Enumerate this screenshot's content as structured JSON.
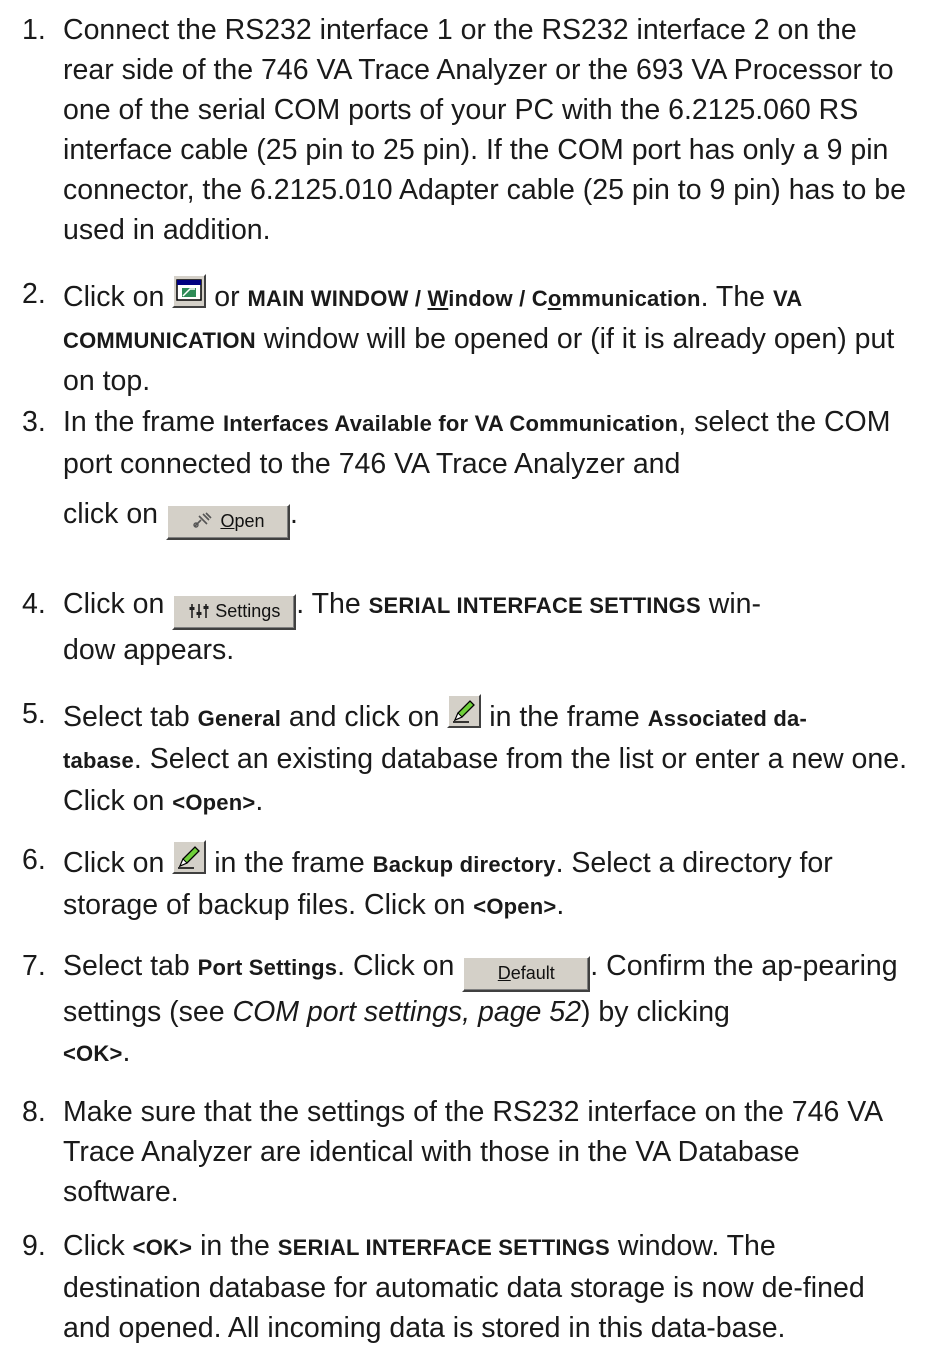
{
  "steps": [
    {
      "num": "1.",
      "text": "Connect the RS232 interface 1 or the RS232 interface 2 on the rear side of the 746 VA Trace Analyzer or the 693 VA Processor to one of the serial COM ports of your PC with the 6.2125.060 RS interface cable (25 pin to 25 pin). If the COM port has only a 9 pin connector, the 6.2125.010 Adapter cable (25 pin to 9 pin) has to be used in addition."
    },
    {
      "num": "2.",
      "pre": "Click on",
      "or": " or ",
      "menu_a": "MAIN WINDOW / ",
      "menu_w": "W",
      "menu_b": "indow / C",
      "menu_o": "o",
      "menu_c": "mmunication",
      "mid": ". The",
      "window_name": "VA COMMUNICATION",
      "post": " window will be opened or (if it is already open) put on top."
    },
    {
      "num": "3.",
      "pre": "In the frame ",
      "frame_name": "Interfaces Available for VA Communication",
      "mid": ", select the COM port connected to the 746 VA Trace Analyzer and",
      "click": "click on",
      "button_label_u": "O",
      "button_label": "pen",
      "post": "."
    },
    {
      "num": "4.",
      "pre": "Click on",
      "button_label": "Settings",
      "mid": ". The ",
      "window_name": "SERIAL INTERFACE SETTINGS",
      "post_line1": " win-",
      "post_line2": "dow appears."
    },
    {
      "num": "5.",
      "pre": "Select tab ",
      "tab_name": "General",
      "mid": " and click on",
      "mid2": " in the frame ",
      "frame_name_1": "Associated da-",
      "frame_name_2": "tabase",
      "post": ". Select an existing database from the list or enter a new one. Click on ",
      "key": "<Open>",
      "end": "."
    },
    {
      "num": "6.",
      "pre": "Click on",
      "mid": " in the frame ",
      "frame_name": "Backup directory",
      "post": ". Select a directory for storage of backup files. Click on ",
      "key": "<Open>",
      "end": "."
    },
    {
      "num": "7.",
      "pre": "Select tab ",
      "tab_name": "Port Settings",
      "mid": ". Click on",
      "button_label_u": "D",
      "button_label": "efault",
      "post": ". Confirm the ap-pearing settings (see ",
      "ref": "COM port settings, page 52",
      "post2": ") by clicking",
      "key": "<OK>",
      "end": "."
    },
    {
      "num": "8.",
      "text": "Make sure that the settings of the RS232 interface on the 746 VA Trace Analyzer are identical with those in the VA Database software."
    },
    {
      "num": "9.",
      "pre": "Click ",
      "key": "<OK>",
      "mid": " in the ",
      "window_name": "SERIAL INTERFACE SETTINGS",
      "post": " window. The destination database for automatic data storage is now de-fined and opened. All incoming data is stored in this data-base."
    }
  ]
}
